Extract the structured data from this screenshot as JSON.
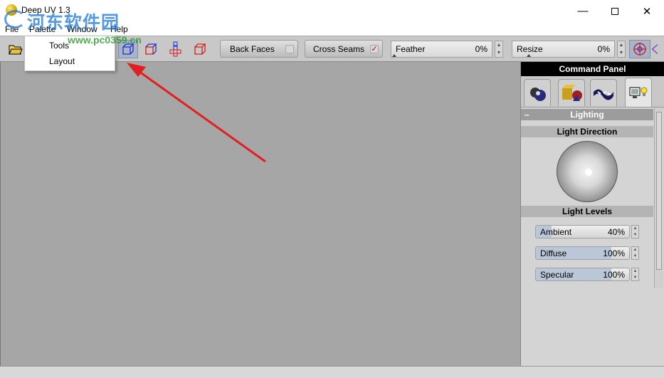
{
  "window": {
    "title": "Deep UV 1.3",
    "minimize_glyph": "—",
    "close_glyph": "✕"
  },
  "watermark": {
    "text": "河东软件园",
    "url": "www.pc0359.cn"
  },
  "menubar": {
    "items": [
      {
        "label": "File"
      },
      {
        "label": "Palette"
      },
      {
        "label": "Window"
      },
      {
        "label": "Help"
      }
    ]
  },
  "palette_menu": {
    "items": [
      {
        "label": "Tools"
      },
      {
        "label": "Layout"
      }
    ]
  },
  "toolbar": {
    "back_faces": {
      "label": "Back Faces",
      "checked": false
    },
    "cross_seams": {
      "label": "Cross Seams",
      "checked": true,
      "check_glyph": "✓"
    },
    "feather": {
      "label": "Feather",
      "value": "0%"
    },
    "resize": {
      "label": "Resize",
      "value": "0%"
    },
    "spin_up": "▲",
    "spin_down": "▼"
  },
  "command_panel": {
    "title": "Command Panel",
    "tabs": [
      {
        "icon": "material-spheres-icon"
      },
      {
        "icon": "objects-icon"
      },
      {
        "icon": "checker-uv-icon"
      },
      {
        "icon": "display-light-icon"
      }
    ],
    "section": {
      "collapse_glyph": "–",
      "title": "Lighting"
    },
    "light_direction_label": "Light Direction",
    "light_levels_label": "Light Levels",
    "levels": [
      {
        "label": "Ambient",
        "value": "40%",
        "fraction": 0.4
      },
      {
        "label": "Diffuse",
        "value": "100%",
        "fraction": 1.0
      },
      {
        "label": "Specular",
        "value": "100%",
        "fraction": 1.0
      }
    ]
  },
  "colors": {
    "canvas": "#a6a6a6",
    "panel_title_bg": "#000000",
    "arrow": "#e02020",
    "watermark": "#1e78d2"
  }
}
